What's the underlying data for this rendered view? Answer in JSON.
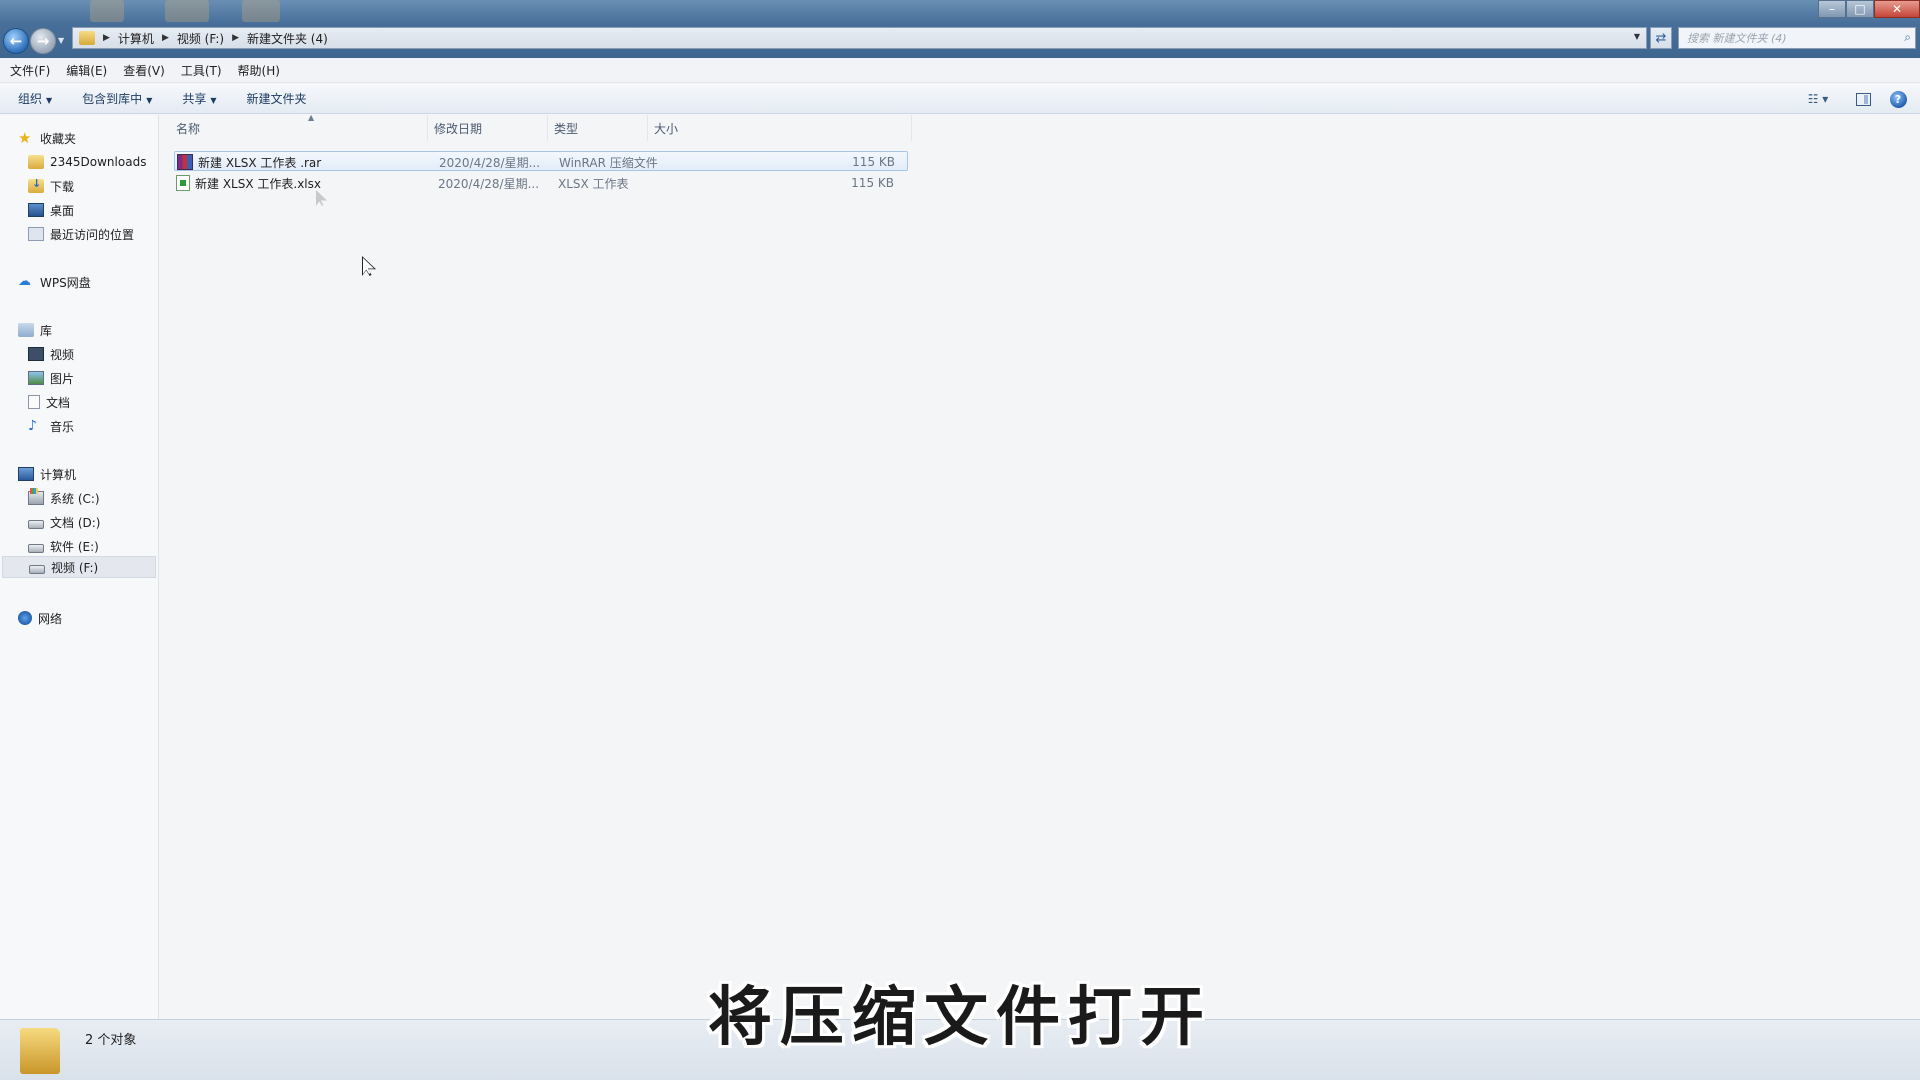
{
  "window": {
    "address": [
      "计算机",
      "视频 (F:)",
      "新建文件夹 (4)"
    ],
    "search_placeholder": "搜索 新建文件夹 (4)",
    "controls": {
      "minimize": "–",
      "maximize": "□",
      "close": "✕"
    }
  },
  "menubar": [
    "文件(F)",
    "编辑(E)",
    "查看(V)",
    "工具(T)",
    "帮助(H)"
  ],
  "toolbar": {
    "organize": "组织",
    "include_library": "包含到库中",
    "share": "共享",
    "new_folder": "新建文件夹"
  },
  "sidebar": {
    "favorites": {
      "label": "收藏夹",
      "items": [
        "2345Downloads",
        "下载",
        "桌面",
        "最近访问的位置"
      ]
    },
    "wps": "WPS网盘",
    "libraries": {
      "label": "库",
      "items": [
        "视频",
        "图片",
        "文档",
        "音乐"
      ]
    },
    "computer": {
      "label": "计算机",
      "items": [
        "系统 (C:)",
        "文档 (D:)",
        "软件 (E:)",
        "视频 (F:)"
      ],
      "selected": "视频 (F:)"
    },
    "network": "网络"
  },
  "columns": {
    "name": "名称",
    "date": "修改日期",
    "type": "类型",
    "size": "大小"
  },
  "files": [
    {
      "name": "新建 XLSX 工作表 .rar",
      "date": "2020/4/28/星期...",
      "type": "WinRAR 压缩文件",
      "size": "115 KB",
      "icon": "rar-icon",
      "selected": true
    },
    {
      "name": "新建 XLSX 工作表.xlsx",
      "date": "2020/4/28/星期...",
      "type": "XLSX 工作表",
      "size": "115 KB",
      "icon": "xlsx-icon",
      "selected": false
    }
  ],
  "status": {
    "count": "2 个对象"
  },
  "subtitle": "将压缩文件打开"
}
